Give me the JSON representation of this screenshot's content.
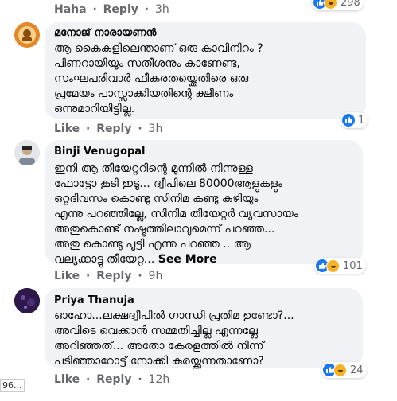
{
  "top_actions": {
    "haha": "Haha",
    "sep": "·",
    "reply": "Reply",
    "time": "3h",
    "reaction_count": "298"
  },
  "comments": [
    {
      "author": "മനോജ് നാരായണൻ",
      "lines": [
        "ആ കൈകളിലെന്താണ് ഒരു കാവിനിറം ?",
        "പിണറായിയും സതീശനും കാണേണ്ട,",
        "സംഘപരിവാർ ഫീകരതയ്ക്കെതിരെ ഒരു",
        "പ്രമേയം പാസ്സാക്കിയതിന്റെ ക്ഷീണം",
        "ഒന്നുമാറിയിട്ടില്ല."
      ],
      "reaction_count": "1",
      "like": "Like",
      "sep": "·",
      "reply": "Reply",
      "time": "3h"
    },
    {
      "author": "Binji Venugopal",
      "lines": [
        "ഇനി ആ തീയേറ്ററിന്റെ മുന്നിൽ നിന്നുള്ള",
        "ഫോട്ടോ കൂടി ഇടൂ... ദ്വീപിലെ 80000ആളുകളും",
        "ഒറ്റദിവസം കൊണ്ടു സിനിമ കണ്ടു കഴിയും",
        "എന്നു പറഞ്ഞില്ലേ, സിനിമ തീയേറ്റർ വ്യവസായം",
        "അതുകൊണ്ട് നഷ്ടത്തിലാവുമെന്ന് പറഞ്ഞ...",
        "അതു കൊണ്ടു പൂട്ടി എന്നു പറഞ്ഞ .. ആ",
        "വല്യക്കാട്ടു തീയേറ്റ..."
      ],
      "see_more": "See More",
      "reaction_count": "101",
      "like": "Like",
      "sep": "·",
      "reply": "Reply",
      "time": "9h"
    },
    {
      "author": "Priya Thanuja",
      "lines": [
        "ഓഹോ...ലക്ഷദ്വീപിൽ ഗാന്ധി പ്രതിമ ഉണ്ടോ?...",
        "അവിടെ വെക്കാൻ സമ്മതിച്ചില്ല എന്നല്ലേ",
        "അറിഞ്ഞത്... അതോ കേരളത്തിൽ നിന്ന്",
        "പടിഞ്ഞാറോട്ട് നോക്കി കുരയ്ക്കുന്നതാണോ?"
      ],
      "reaction_count": "24",
      "like": "Like",
      "sep": "·",
      "reply": "Reply",
      "time": "12h"
    }
  ],
  "left_edge_text": "96...",
  "colors": {
    "like_blue": "#1877f2",
    "haha_yellow": "#f7b125",
    "bubble": "#f0f2f5",
    "meta_gray": "#65676b"
  }
}
